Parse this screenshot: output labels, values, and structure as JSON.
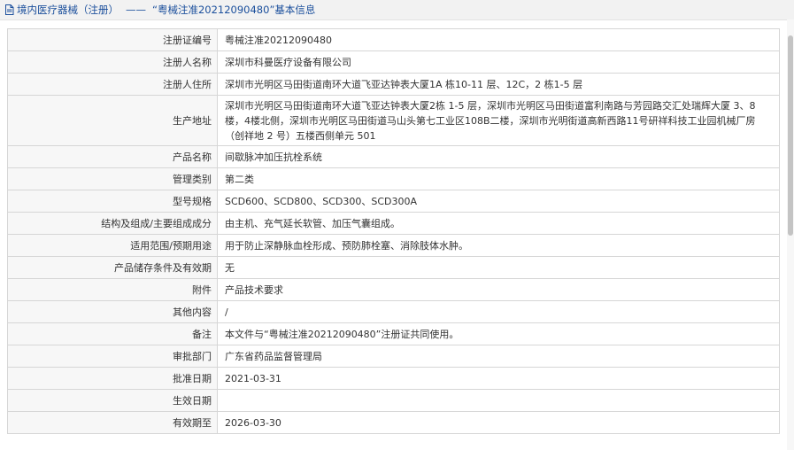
{
  "header": {
    "title": "境内医疗器械（注册）",
    "separator": "——",
    "subtitle": "“粤械注准20212090480”基本信息",
    "icon": "document-icon",
    "accent_color": "#1b4f9c"
  },
  "rows": [
    {
      "key": "注册证编号",
      "value": "粤械注准20212090480"
    },
    {
      "key": "注册人名称",
      "value": "深圳市科曼医疗设备有限公司"
    },
    {
      "key": "注册人住所",
      "value": "深圳市光明区马田街道南环大道飞亚达钟表大厦1A 栋10-11 层、12C，2 栋1-5 层"
    },
    {
      "key": "生产地址",
      "value": "深圳市光明区马田街道南环大道飞亚达钟表大厦2栋 1-5 层，深圳市光明区马田街道富利南路与芳园路交汇处瑞辉大厦 3、8 楼，4楼北侧，深圳市光明区马田街道马山头第七工业区108B二楼，深圳市光明街道高新西路11号研祥科技工业园机械厂房（创祥地 2 号）五楼西侧单元 501"
    },
    {
      "key": "产品名称",
      "value": "间歇脉冲加压抗栓系统"
    },
    {
      "key": "管理类别",
      "value": "第二类"
    },
    {
      "key": "型号规格",
      "value": "SCD600、SCD800、SCD300、SCD300A"
    },
    {
      "key": "结构及组成/主要组成成分",
      "value": "由主机、充气延长软管、加压气囊组成。"
    },
    {
      "key": "适用范围/预期用途",
      "value": "用于防止深静脉血栓形成、预防肺栓塞、消除肢体水肿。"
    },
    {
      "key": "产品储存条件及有效期",
      "value": "无"
    },
    {
      "key": "附件",
      "value": "产品技术要求"
    },
    {
      "key": "其他内容",
      "value": "/"
    },
    {
      "key": "备注",
      "value": "本文件与“粤械注准20212090480”注册证共同使用。"
    },
    {
      "key": "审批部门",
      "value": "广东省药品监督管理局"
    },
    {
      "key": "批准日期",
      "value": "2021-03-31"
    },
    {
      "key": "生效日期",
      "value": ""
    },
    {
      "key": "有效期至",
      "value": "2026-03-30"
    }
  ]
}
